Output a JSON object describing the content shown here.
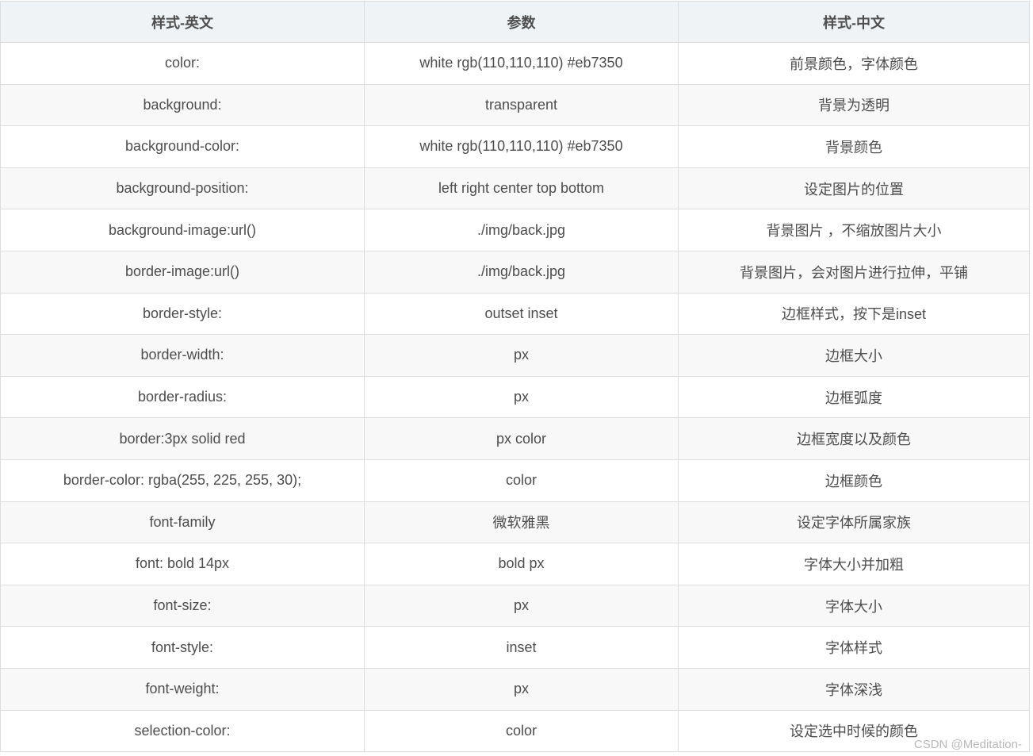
{
  "table": {
    "headers": [
      "样式-英文",
      "参数",
      "样式-中文"
    ],
    "rows": [
      [
        "color:",
        "white rgb(110,110,110) #eb7350",
        "前景颜色，字体颜色"
      ],
      [
        "background:",
        "transparent",
        "背景为透明"
      ],
      [
        "background-color:",
        "white rgb(110,110,110) #eb7350",
        "背景颜色"
      ],
      [
        "background-position:",
        "left right center top bottom",
        "设定图片的位置"
      ],
      [
        "background-image:url()",
        "./img/back.jpg",
        "背景图片 ，不缩放图片大小"
      ],
      [
        "border-image:url()",
        "./img/back.jpg",
        "背景图片，会对图片进行拉伸，平铺"
      ],
      [
        "border-style:",
        "outset inset",
        "边框样式，按下是inset"
      ],
      [
        "border-width:",
        "px",
        "边框大小"
      ],
      [
        "border-radius:",
        "px",
        "边框弧度"
      ],
      [
        "border:3px solid red",
        "px color",
        "边框宽度以及颜色"
      ],
      [
        "border-color: rgba(255, 225, 255, 30);",
        "color",
        "边框颜色"
      ],
      [
        "font-family",
        "微软雅黑",
        "设定字体所属家族"
      ],
      [
        "font: bold 14px",
        "bold px",
        "字体大小并加粗"
      ],
      [
        "font-size:",
        "px",
        "字体大小"
      ],
      [
        "font-style:",
        "inset",
        "字体样式"
      ],
      [
        "font-weight:",
        "px",
        "字体深浅"
      ],
      [
        "selection-color:",
        "color",
        "设定选中时候的颜色"
      ]
    ]
  },
  "watermark": "CSDN @Meditation-",
  "colors": {
    "header_bg": "#eff3f5",
    "row_alt_bg": "#f8f8f8",
    "border": "#dddddd",
    "text": "#4d4d4d"
  }
}
